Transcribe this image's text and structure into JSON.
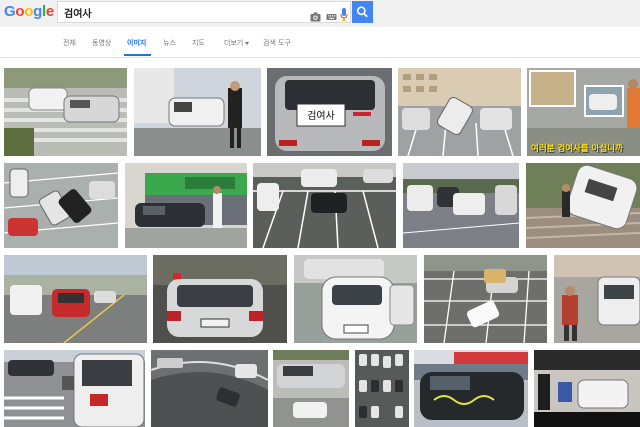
{
  "logo": {
    "letters": [
      "G",
      "o",
      "o",
      "g",
      "l",
      "e"
    ],
    "colors": [
      "#4285f4",
      "#ea4335",
      "#fbbc05",
      "#4285f4",
      "#34a853",
      "#ea4335"
    ]
  },
  "search": {
    "query": "검여사"
  },
  "tabs": [
    {
      "label": "전체",
      "active": false
    },
    {
      "label": "동영상",
      "active": false
    },
    {
      "label": "이미지",
      "active": true
    },
    {
      "label": "뉴스",
      "active": false
    },
    {
      "label": "지도",
      "active": false
    },
    {
      "label": "더보기",
      "active": false
    },
    {
      "label": "검색 도구",
      "active": false
    }
  ],
  "images": [
    {
      "alt": "parked cars on stairs"
    },
    {
      "alt": "car at building entrance"
    },
    {
      "alt": "car rear window sign",
      "sign_text": "검여사"
    },
    {
      "alt": "car tipped over in lot"
    },
    {
      "alt": "collage with caption",
      "caption": "여러분 검여사를 아십니까"
    },
    {
      "alt": "cars in lot aerial"
    },
    {
      "alt": "car at shop front"
    },
    {
      "alt": "cars in parking lot"
    },
    {
      "alt": "vans in parking lot"
    },
    {
      "alt": "car on stairs"
    },
    {
      "alt": "street with trucks"
    },
    {
      "alt": "sedan rear view"
    },
    {
      "alt": "white car front view"
    },
    {
      "alt": "parking lot aerial"
    },
    {
      "alt": "person near cars"
    },
    {
      "alt": "car front closeup"
    },
    {
      "alt": "road aerial"
    },
    {
      "alt": "cars on road"
    },
    {
      "alt": "parking garage aerial"
    },
    {
      "alt": "car with graffiti"
    },
    {
      "alt": "news scene"
    }
  ]
}
